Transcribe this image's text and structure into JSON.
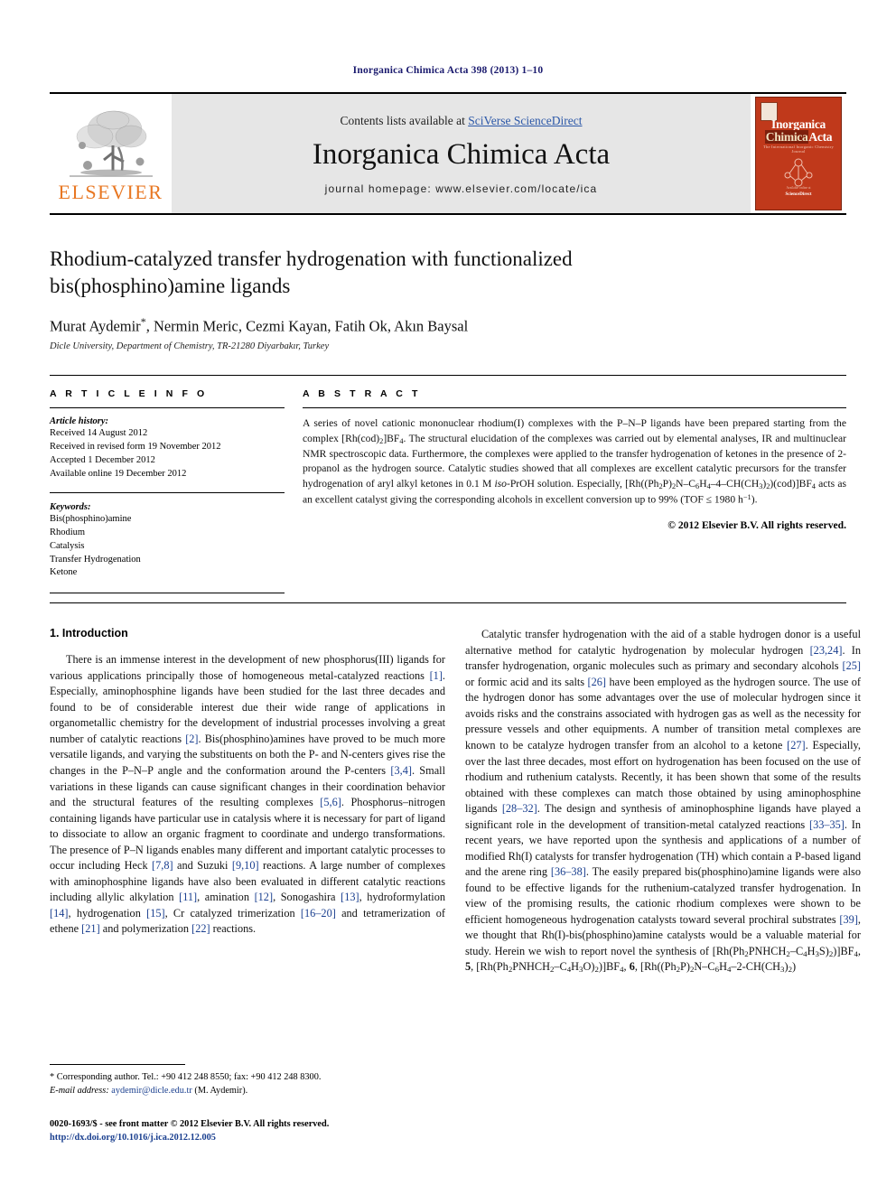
{
  "running_head": "Inorganica Chimica Acta 398 (2013) 1–10",
  "masthead": {
    "publisher_name": "ELSEVIER",
    "contents_prefix": "Contents lists available at ",
    "contents_link": "SciVerse ScienceDirect",
    "journal_title": "Inorganica Chimica Acta",
    "homepage": "journal homepage: www.elsevier.com/locate/ica",
    "cover": {
      "line1": "Inorganica",
      "line2_word1": "Chimica",
      "line2_word2": "Acta",
      "subtitle": "The International Inorganic Chemistry Journal",
      "foot_small": "Available online at",
      "foot_brand": "ScienceDirect"
    }
  },
  "article": {
    "title": "Rhodium-catalyzed transfer hydrogenation with functionalized bis(phosphino)amine ligands",
    "authors": "Murat Aydemir",
    "authors_rest": ", Nermin Meric, Cezmi Kayan, Fatih Ok, Akın Baysal",
    "corresponding_marker": "*",
    "affiliation": "Dicle University, Department of Chemistry, TR-21280 Diyarbakır, Turkey"
  },
  "article_info": {
    "label": "A R T I C L E    I N F O",
    "history_label": "Article history:",
    "history": [
      "Received 14 August 2012",
      "Received in revised form 19 November 2012",
      "Accepted 1 December 2012",
      "Available online 19 December 2012"
    ],
    "keywords_label": "Keywords:",
    "keywords": [
      "Bis(phosphino)amine",
      "Rhodium",
      "Catalysis",
      "Transfer Hydrogenation",
      "Ketone"
    ]
  },
  "abstract": {
    "label": "A B S T R A C T",
    "copyright": "© 2012 Elsevier B.V. All rights reserved."
  },
  "introduction": {
    "heading": "1. Introduction"
  },
  "footnotes": {
    "corresponding": "* Corresponding author. Tel.: +90 412 248 8550; fax: +90 412 248 8300.",
    "email_label": "E-mail address:",
    "email": "aydemir@dicle.edu.tr",
    "email_suffix": " (M. Aydemir)."
  },
  "footer": {
    "issn_line": "0020-1693/$ - see front matter © 2012 Elsevier B.V. All rights reserved.",
    "doi": "http://dx.doi.org/10.1016/j.ica.2012.12.005"
  },
  "colors": {
    "link": "#2b57a8",
    "reference": "#1a3f8f",
    "elsevier_orange": "#E87722",
    "cover_red": "#C0391B",
    "running_head": "#1a1a6e"
  }
}
